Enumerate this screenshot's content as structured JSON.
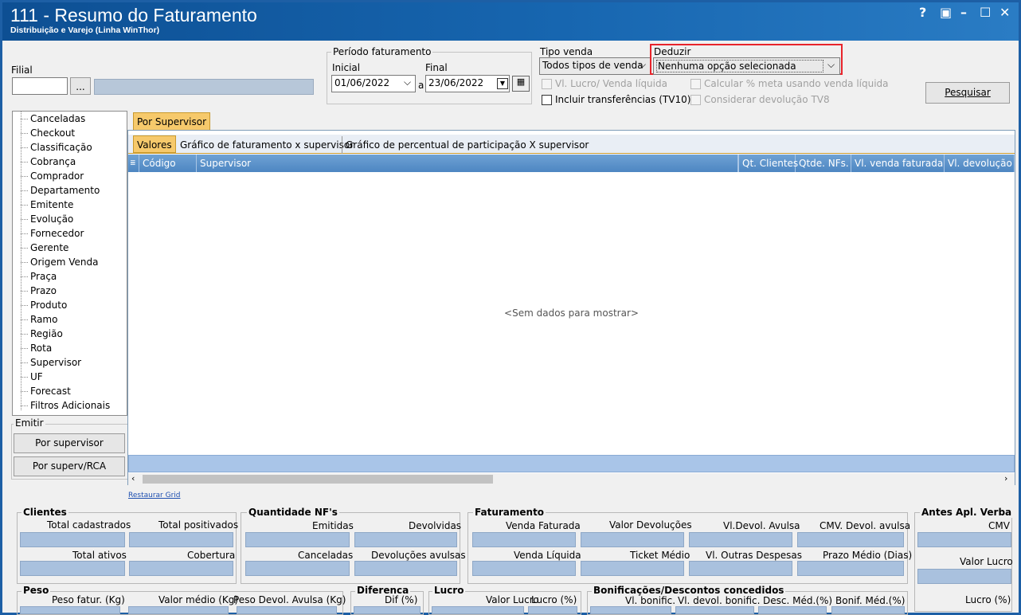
{
  "window": {
    "title": "111 - Resumo do Faturamento",
    "subtitle": "Distribuição e Varejo (Linha WinThor)",
    "controls": [
      "?",
      "▣",
      "–",
      "☐",
      "✕"
    ]
  },
  "filial": {
    "label": "Filial",
    "code": "",
    "name": "",
    "browse": "..."
  },
  "periodo": {
    "label": "Período faturamento",
    "inicial_label": "Inicial",
    "final_label": "Final",
    "inicial": "01/06/2022",
    "sep": "a",
    "final": "23/06/2022"
  },
  "tipo_venda": {
    "label": "Tipo venda",
    "value": "Todos tipos de venda"
  },
  "deduzir": {
    "label": "Deduzir",
    "value": "Nenhuma opção selecionada",
    "highlight": "#e8242b"
  },
  "checks": {
    "vl_lucro": "Vl. Lucro/ Venda líquida",
    "incluir": "Incluir transferências (TV10)",
    "calcular": "Calcular % meta usando venda líquida",
    "considerar": "Considerar devolução TV8"
  },
  "pesquisar": "Pesquisar",
  "tree": [
    "Canceladas",
    "Checkout",
    "Classificação",
    "Cobrança",
    "Comprador",
    "Departamento",
    "Emitente",
    "Evolução",
    "Fornecedor",
    "Gerente",
    "Origem Venda",
    "Praça",
    "Prazo",
    "Produto",
    "Ramo",
    "Região",
    "Rota",
    "Supervisor",
    "UF",
    "Forecast",
    "Filtros Adicionais"
  ],
  "emitir": {
    "label": "Emitir",
    "btn1": "Por supervisor",
    "btn2": "Por superv/RCA"
  },
  "main_tab": "Por Supervisor",
  "sub_tabs": [
    "Valores",
    "Gráfico de faturamento x supervisor",
    "Gráfico de percentual de participação X supervisor"
  ],
  "columns": [
    "Código",
    "Supervisor",
    "Qt. Clientes",
    "Qtde. NFs.",
    "Vl. venda faturada",
    "Vl. devolução"
  ],
  "empty": "<Sem dados para mostrar>",
  "restaurar": "Restaurar Grid",
  "clientes": {
    "title": "Clientes",
    "f1": "Total cadastrados",
    "f2": "Total positivados",
    "f3": "Total ativos",
    "f4": "Cobertura"
  },
  "qtd_nf": {
    "title": "Quantidade NF's",
    "f1": "Emitidas",
    "f2": "Devolvidas",
    "f3": "Canceladas",
    "f4": "Devoluções avulsas"
  },
  "faturamento": {
    "title": "Faturamento",
    "f1": "Venda Faturada",
    "f2": "Valor Devoluções",
    "f3": "Vl.Devol. Avulsa",
    "f4": "CMV. Devol. avulsa",
    "f5": "Venda Líquida",
    "f6": "Ticket Médio",
    "f7": "Vl. Outras Despesas",
    "f8": "Prazo Médio (Dias)"
  },
  "antes": {
    "title": "Antes Apl. Verba",
    "f1": "CMV",
    "f2": "Valor Lucro",
    "f3": "Lucro (%)"
  },
  "peso": {
    "title": "Peso",
    "f1": "Peso fatur. (Kg)",
    "f2": "Valor médio (Kg)",
    "f3": "Peso Devol. Avulsa (Kg)"
  },
  "diferenca": {
    "title": "Diferenca",
    "f1": "Dif (%)"
  },
  "lucro": {
    "title": "Lucro",
    "f1": "Valor Lucro",
    "f2": "Lucro (%)"
  },
  "bonif": {
    "title": "Bonificações/Descontos concedidos",
    "f1": "Vl. bonific.",
    "f2": "Vl. devol. bonific.",
    "f3": "Desc. Méd.(%)",
    "f4": "Bonif. Méd.(%)"
  }
}
